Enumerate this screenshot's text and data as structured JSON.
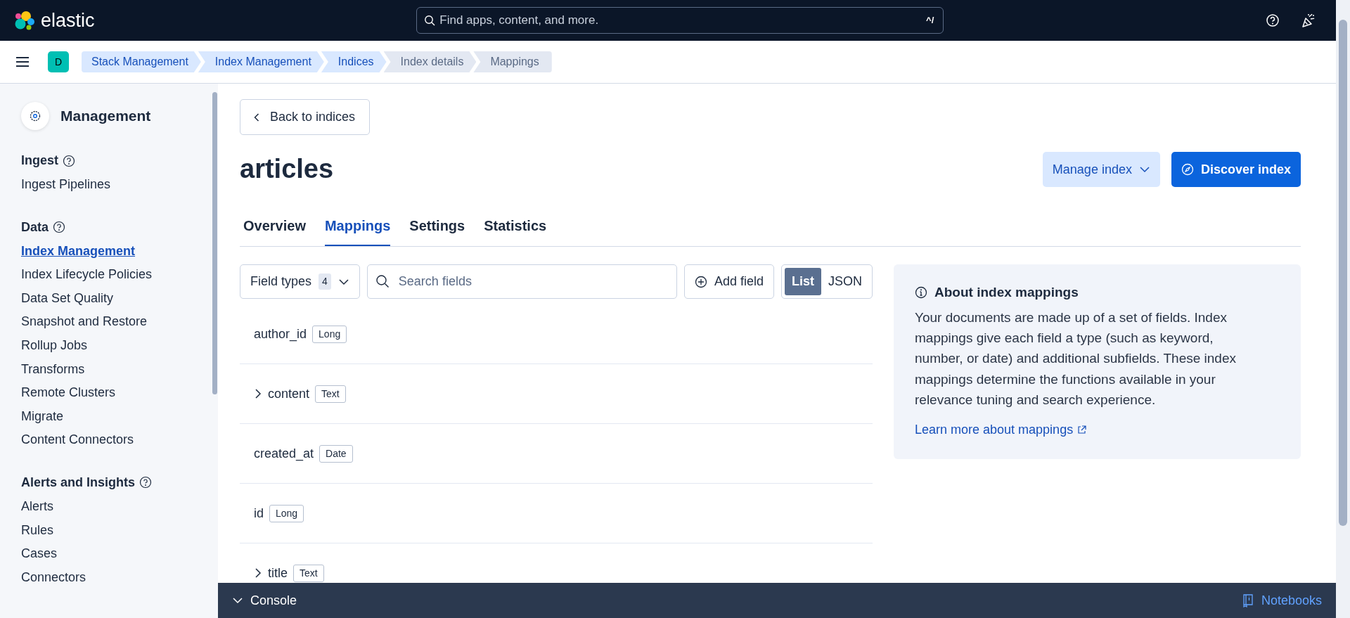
{
  "header": {
    "logo_text": "elastic",
    "search": {
      "placeholder": "Find apps, content, and more.",
      "shortcut": "^/"
    }
  },
  "breadcrumbs": {
    "space_initial": "D",
    "items": [
      {
        "label": "Stack Management",
        "linked": true
      },
      {
        "label": "Index Management",
        "linked": true
      },
      {
        "label": "Indices",
        "linked": true
      },
      {
        "label": "Index details",
        "linked": false
      },
      {
        "label": "Mappings",
        "linked": false
      }
    ]
  },
  "sidebar": {
    "title": "Management",
    "sections": [
      {
        "title": "Ingest",
        "items": [
          {
            "label": "Ingest Pipelines",
            "selected": false
          }
        ]
      },
      {
        "title": "Data",
        "items": [
          {
            "label": "Index Management",
            "selected": true
          },
          {
            "label": "Index Lifecycle Policies",
            "selected": false
          },
          {
            "label": "Data Set Quality",
            "selected": false
          },
          {
            "label": "Snapshot and Restore",
            "selected": false
          },
          {
            "label": "Rollup Jobs",
            "selected": false
          },
          {
            "label": "Transforms",
            "selected": false
          },
          {
            "label": "Remote Clusters",
            "selected": false
          },
          {
            "label": "Migrate",
            "selected": false
          },
          {
            "label": "Content Connectors",
            "selected": false
          }
        ]
      },
      {
        "title": "Alerts and Insights",
        "items": [
          {
            "label": "Alerts",
            "selected": false
          },
          {
            "label": "Rules",
            "selected": false
          },
          {
            "label": "Cases",
            "selected": false
          },
          {
            "label": "Connectors",
            "selected": false
          }
        ]
      }
    ]
  },
  "page": {
    "back_button": "Back to indices",
    "title": "articles",
    "actions": [
      {
        "label": "Manage index",
        "kind": "secondary"
      },
      {
        "label": "Discover index",
        "kind": "primary"
      }
    ],
    "tabs": [
      {
        "label": "Overview",
        "selected": false
      },
      {
        "label": "Mappings",
        "selected": true
      },
      {
        "label": "Settings",
        "selected": false
      },
      {
        "label": "Statistics",
        "selected": false
      }
    ],
    "toolbar": {
      "field_types": {
        "label": "Field types",
        "count": "4"
      },
      "search": {
        "placeholder": "Search fields"
      },
      "add_field": "Add field",
      "view_toggle": [
        {
          "label": "List",
          "selected": true
        },
        {
          "label": "JSON",
          "selected": false
        }
      ]
    },
    "fields": [
      {
        "name": "author_id",
        "type": "Long",
        "expandable": false
      },
      {
        "name": "content",
        "type": "Text",
        "expandable": true
      },
      {
        "name": "created_at",
        "type": "Date",
        "expandable": false
      },
      {
        "name": "id",
        "type": "Long",
        "expandable": false
      },
      {
        "name": "title",
        "type": "Text",
        "expandable": true
      }
    ],
    "info_panel": {
      "title": "About index mappings",
      "body": "Your documents are made up of a set of fields. Index mappings give each field a type (such as keyword, number, or date) and additional subfields. These index mappings determine the functions available in your relevance tuning and search experience.",
      "link": "Learn more about mappings"
    }
  },
  "bottom_bar": {
    "console": "Console",
    "notebooks": "Notebooks"
  }
}
